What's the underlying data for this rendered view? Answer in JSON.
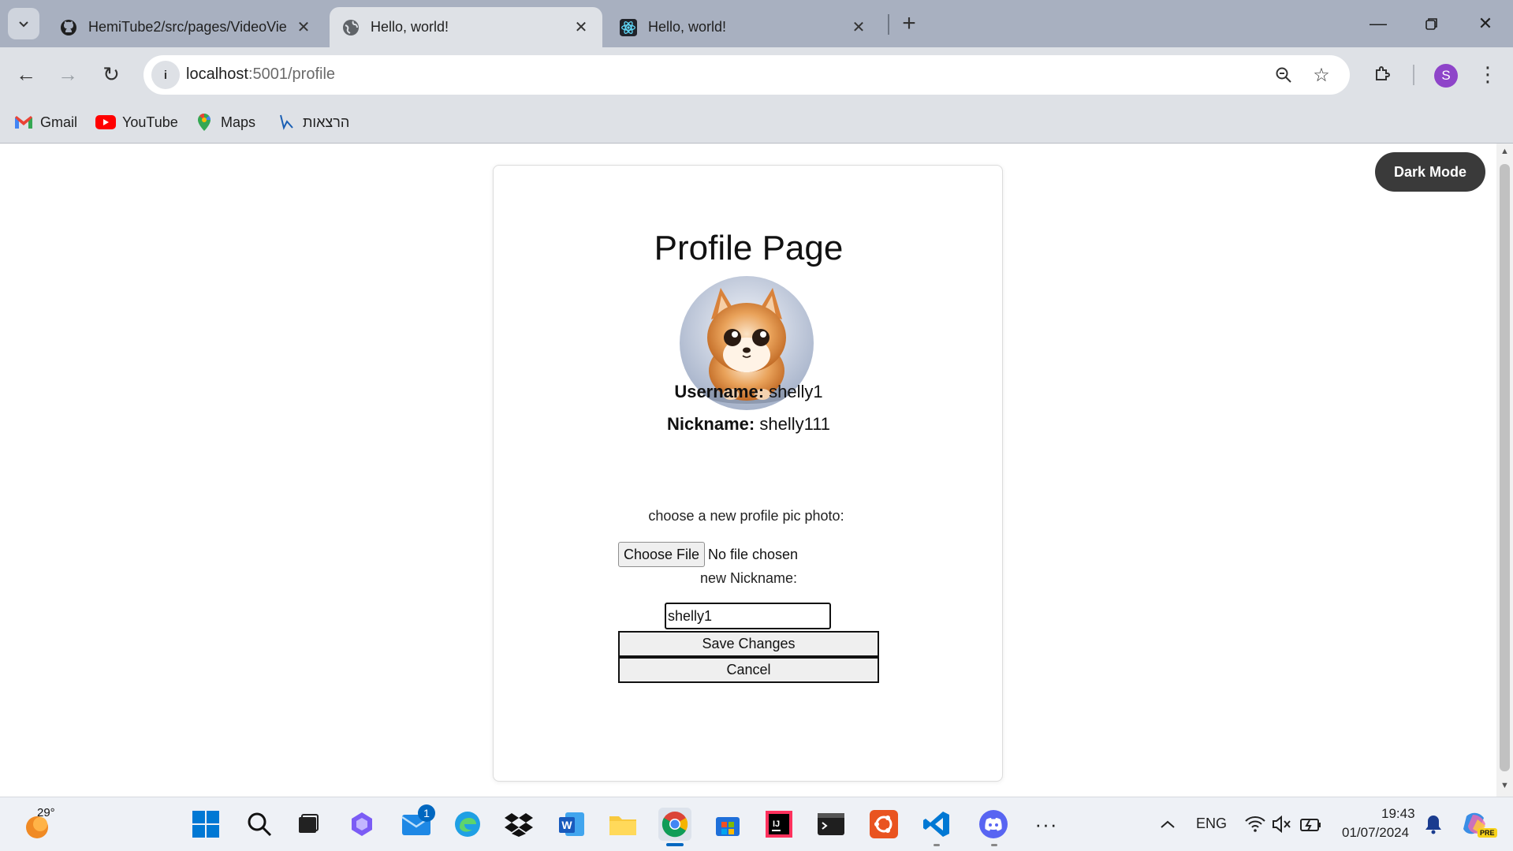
{
  "browser": {
    "tabs": [
      {
        "title": "HemiTube2/src/pages/VideoVie",
        "icon": "github-icon",
        "active": false
      },
      {
        "title": "Hello, world!",
        "icon": "globe-icon",
        "active": true
      },
      {
        "title": "Hello, world!",
        "icon": "react-icon",
        "active": false
      }
    ],
    "url_host": "localhost",
    "url_path": ":5001/profile",
    "profile_initial": "S",
    "bookmarks": [
      {
        "label": "Gmail",
        "icon": "gmail-icon"
      },
      {
        "label": "YouTube",
        "icon": "youtube-icon"
      },
      {
        "label": "Maps",
        "icon": "maps-icon"
      },
      {
        "label": "הרצאות",
        "icon": "lecture-icon"
      }
    ]
  },
  "page": {
    "dark_mode_label": "Dark Mode",
    "title": "Profile Page",
    "username_label": "Username:",
    "username_value": "shelly1",
    "nickname_label": "Nickname:",
    "nickname_value": "shelly111",
    "choose_pic_label": "choose a new profile pic photo:",
    "choose_file_button": "Choose File",
    "file_status": "No file chosen",
    "new_nickname_label": "new Nickname:",
    "new_nickname_value": "shelly1",
    "save_button": "Save Changes",
    "cancel_button": "Cancel"
  },
  "taskbar": {
    "temperature": "29°",
    "mail_badge": "1",
    "language": "ENG",
    "time": "19:43",
    "date": "01/07/2024",
    "copilot_badge": "PRE"
  }
}
